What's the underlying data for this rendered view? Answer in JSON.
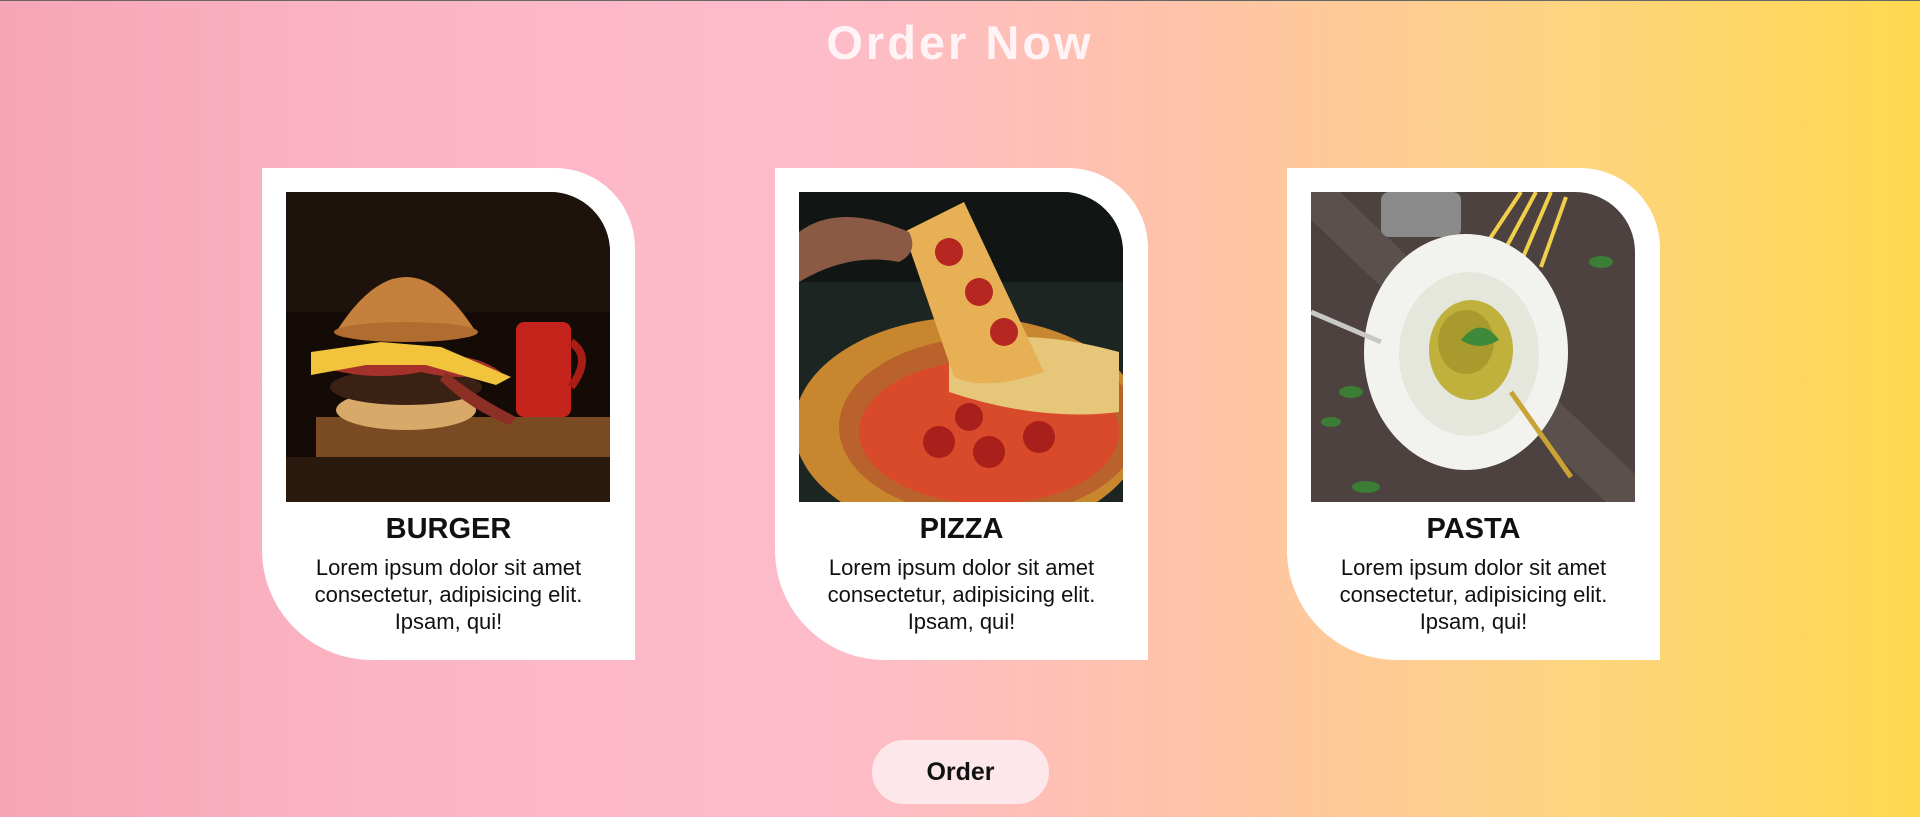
{
  "page": {
    "title": "Order Now"
  },
  "cards": [
    {
      "name": "BURGER",
      "description": "Lorem ipsum dolor sit amet consectetur, adipisicing elit. Ipsam, qui!",
      "image": "burger-photo"
    },
    {
      "name": "PIZZA",
      "description": "Lorem ipsum dolor sit amet consectetur, adipisicing elit. Ipsam, qui!",
      "image": "pizza-photo"
    },
    {
      "name": "PASTA",
      "description": "Lorem ipsum dolor sit amet consectetur, adipisicing elit. Ipsam, qui!",
      "image": "pasta-photo"
    }
  ],
  "order_button": {
    "label": "Order"
  },
  "colors": {
    "gradient_left": "#f6a5b6",
    "gradient_middle": "#fdbbcb",
    "gradient_right": "#ffd84f",
    "card_background": "#ffffff",
    "button_background": "#fde7ea"
  }
}
